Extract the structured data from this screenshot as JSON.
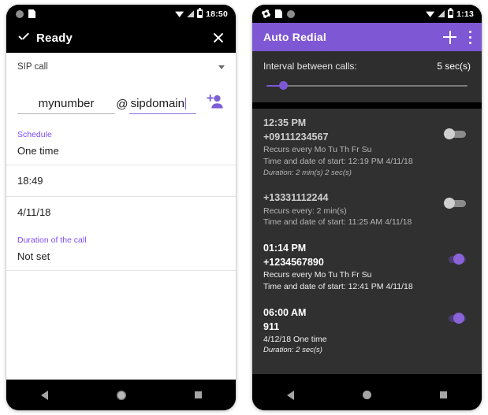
{
  "left_phone": {
    "status_bar": {
      "icons": [
        "circle-icon",
        "sdcard-icon"
      ],
      "right_icons": [
        "wifi-icon",
        "signal-icon",
        "battery-icon"
      ],
      "clock": "18:50"
    },
    "toolbar": {
      "check_icon": "check-icon",
      "title": "Ready",
      "close_icon": "close-icon"
    },
    "spinner": {
      "value": "SIP call",
      "caret_icon": "chevron-down-icon"
    },
    "sip_input": {
      "user_value": "mynumber",
      "at_symbol": "@",
      "domain_value": "sipdomain",
      "add_contact_icon": "add-contact-icon"
    },
    "sections": [
      {
        "label": "Schedule",
        "value": "One time"
      },
      {
        "label": "",
        "value": "18:49"
      },
      {
        "label": "",
        "value": "4/11/18"
      },
      {
        "label": "Duration of the call",
        "value": "Not set"
      }
    ],
    "nav": {
      "back": "back-icon",
      "home": "home-icon",
      "recents": "recents-icon"
    }
  },
  "right_phone": {
    "status_bar": {
      "icons": [
        "gear-icon",
        "sdcard-icon",
        "circle-icon"
      ],
      "right_icons": [
        "wifi-icon",
        "signal-icon",
        "battery-icon"
      ],
      "clock": "1:13"
    },
    "toolbar": {
      "title": "Auto Redial",
      "add_icon": "plus-icon",
      "overflow_icon": "overflow-menu-icon"
    },
    "interval_panel": {
      "label": "Interval between calls:",
      "value": "5 sec(s)",
      "slider_percent": 6
    },
    "alarms": [
      {
        "time": "12:35 PM",
        "number": "+09111234567",
        "recurs": "Recurs every Mo Tu Th Fr Su",
        "start": "Time and date of start: 12:19 PM  4/11/18",
        "duration": "Duration: 2 min(s) 2 sec(s)",
        "enabled": false
      },
      {
        "time": "",
        "number": "+13331112244",
        "recurs": "Recurs every: 2 min(s)",
        "start": "Time and date of start: 11:25 AM  4/11/18",
        "duration": "",
        "enabled": false
      },
      {
        "time": "01:14 PM",
        "number": "+1234567890",
        "recurs": "Recurs every Mo Tu Th Fr Su",
        "start": "Time and date of start: 12:41 PM  4/11/18",
        "duration": "",
        "enabled": true
      },
      {
        "time": "06:00 AM",
        "number": "911",
        "recurs": "4/12/18  One time",
        "start": "",
        "duration": "Duration: 2 sec(s)",
        "enabled": true
      }
    ],
    "nav": {
      "back": "back-icon",
      "home": "home-icon",
      "recents": "recents-icon"
    }
  },
  "colors": {
    "accent_purple": "#7e57d4",
    "link_purple": "#7c4dff",
    "dark_panel": "#2e2e2e",
    "dark_list": "#303030"
  }
}
